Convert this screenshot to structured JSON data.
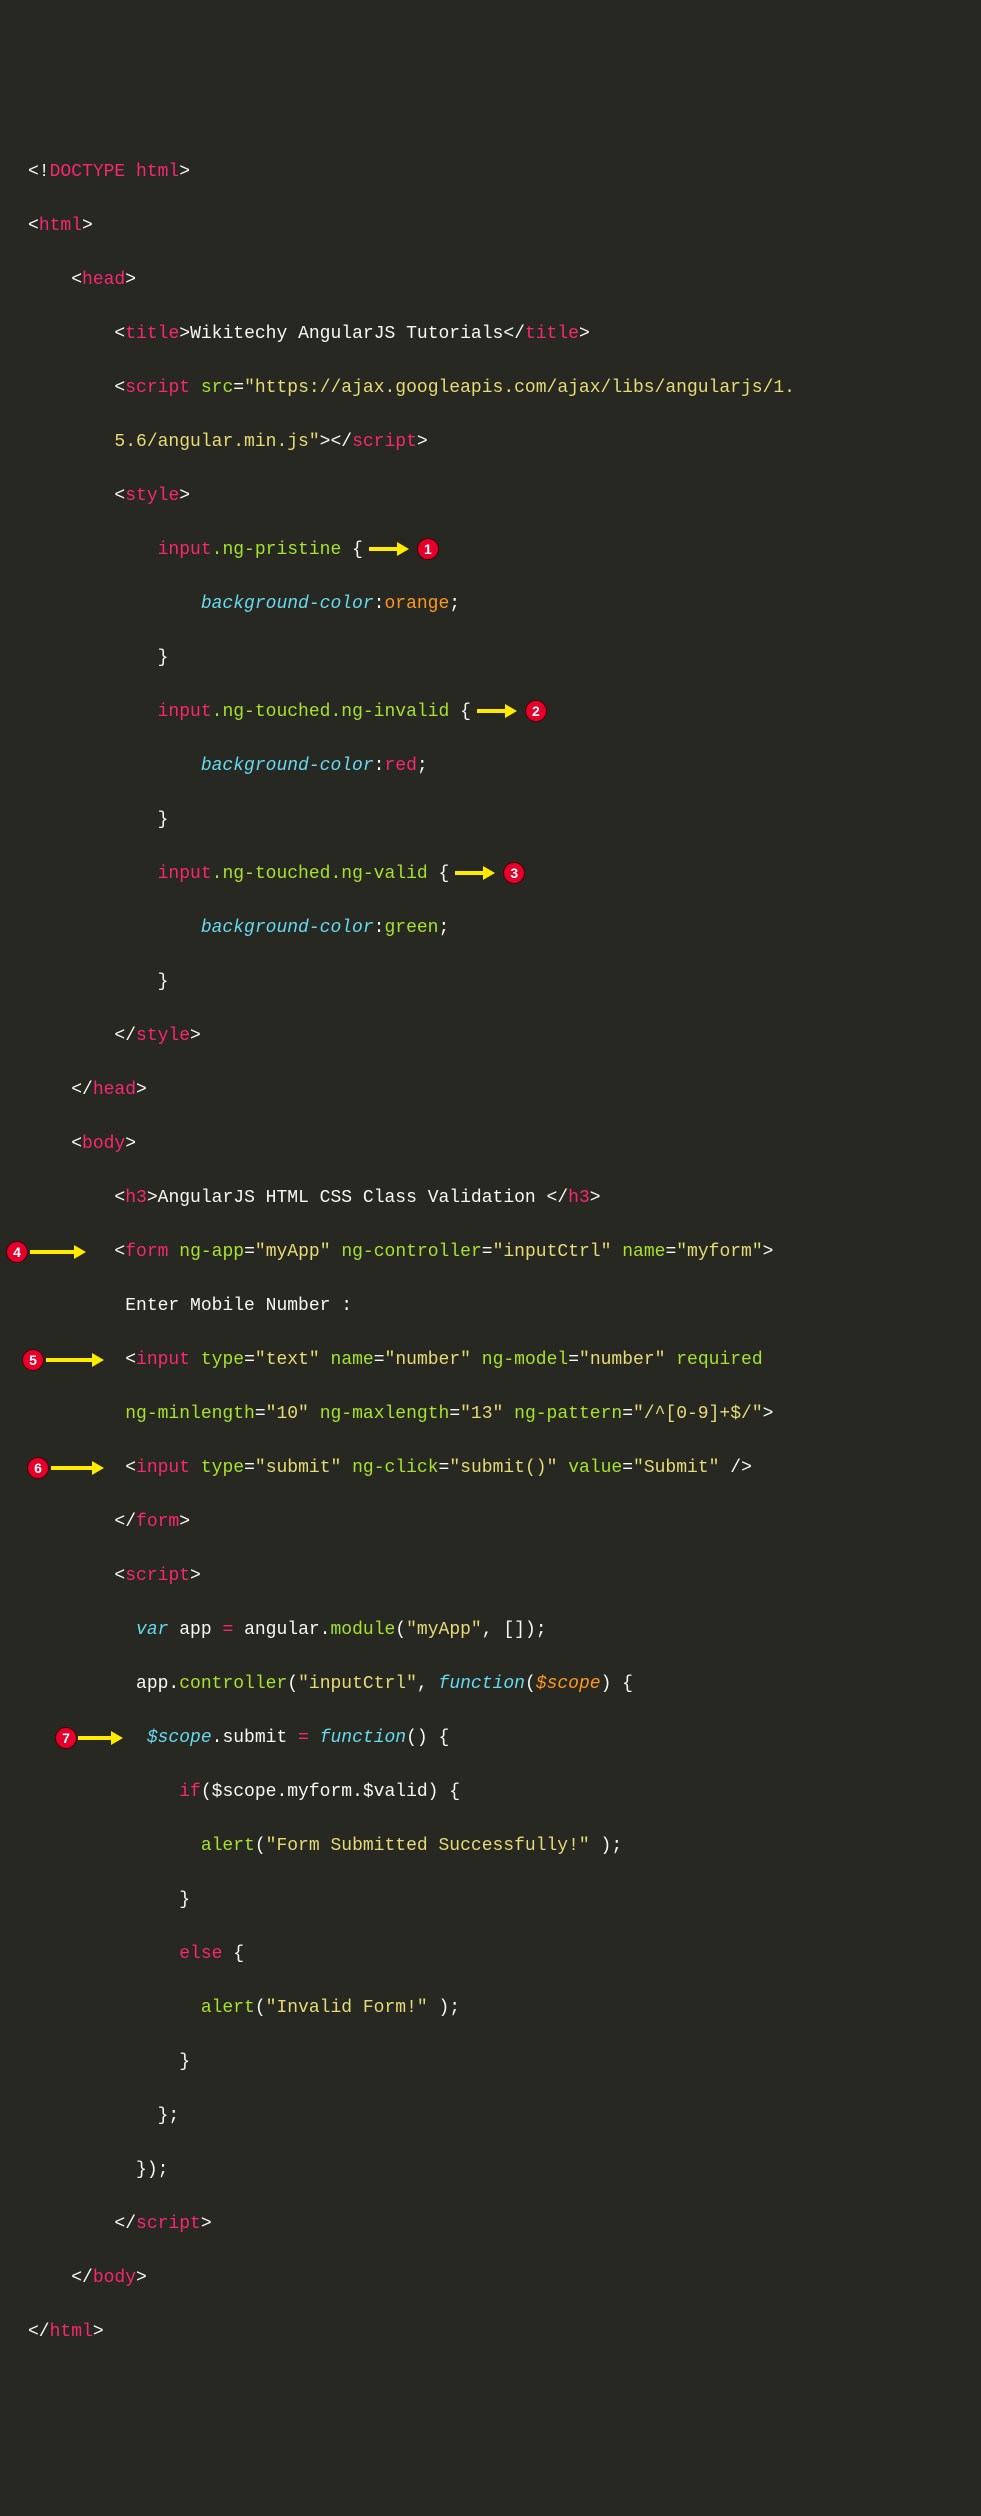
{
  "code": {
    "l1_doctype": "DOCTYPE html",
    "l2_html_open": "html",
    "l3_head_open": "head",
    "l4_title_tag": "title",
    "l4_title_text": "Wikitechy AngularJS Tutorials",
    "l5_script_tag": "script",
    "l5_src_attr": "src",
    "l5_src_val": "\"https://ajax.googleapis.com/ajax/libs/angularjs/1.",
    "l6_src_cont": "5.6/angular.min.js\"",
    "l7_style_open": "style",
    "l8_sel_input": "input",
    "l8_class": ".ng-pristine",
    "l9_prop": "background-color",
    "l9_val": "orange",
    "l11_sel_input": "input",
    "l11_class": ".ng-touched.ng-invalid",
    "l12_prop": "background-color",
    "l12_val": "red",
    "l14_sel_input": "input",
    "l14_class": ".ng-touched.ng-valid",
    "l15_prop": "background-color",
    "l15_val": "green",
    "l17_style_close": "style",
    "l18_head_close": "head",
    "l19_body_open": "body",
    "l20_h3": "h3",
    "l20_h3_text": "AngularJS HTML CSS Class Validation ",
    "l21_form": "form",
    "l21_ngapp_attr": "ng-app",
    "l21_ngapp_val": "\"myApp\"",
    "l21_ngctrl_attr": "ng-controller",
    "l21_ngctrl_val": "\"inputCtrl\"",
    "l21_name_attr": "name",
    "l21_name_val": "\"myform\"",
    "l22_text": "Enter Mobile Number : ",
    "l23_input": "input",
    "l23_type_attr": "type",
    "l23_type_val": "\"text\"",
    "l23_name_attr": "name",
    "l23_name_val": "\"number\"",
    "l23_model_attr": "ng-model",
    "l23_model_val": "\"number\"",
    "l23_req_attr": "required",
    "l24_min_attr": "ng-minlength",
    "l24_min_val": "\"10\"",
    "l24_max_attr": "ng-maxlength",
    "l24_max_val": "\"13\"",
    "l24_pat_attr": "ng-pattern",
    "l24_pat_val": "\"/^[0-9]+$/\"",
    "l25_input": "input",
    "l25_type_attr": "type",
    "l25_type_val": "\"submit\"",
    "l25_click_attr": "ng-click",
    "l25_click_val": "\"submit()\"",
    "l25_value_attr": "value",
    "l25_value_val": "\"Submit\"",
    "l26_form_close": "form",
    "l27_script_open": "script",
    "l28_var": "var",
    "l28_app_text": " app ",
    "l28_eq": "=",
    "l28_ang_text": " angular.",
    "l28_module": "module",
    "l28_myapp_str": "\"myApp\"",
    "l29_ctrl_call": "app.",
    "l29_controller": "controller",
    "l29_ctrlname": "\"inputCtrl\"",
    "l29_function": "function",
    "l29_scope": "$scope",
    "l30_scope": "$scope",
    "l30_submit": ".submit ",
    "l30_eq": "=",
    "l30_function": "function",
    "l31_if": "if",
    "l31_text": "($scope.myform.$valid) {",
    "l32_alert": "alert",
    "l32_str": "\"Form Submitted Successfully!\"",
    "l34_else": "else",
    "l35_alert": "alert",
    "l35_str": "\"Invalid Form!\"",
    "l39_script_close": "script",
    "l40_body_close": "body",
    "l41_html_close": "html"
  },
  "badges": {
    "b1": "1",
    "b2": "2",
    "b3": "3",
    "b4": "4",
    "b5": "5",
    "b6": "6",
    "b7": "7"
  },
  "colors": {
    "background": "#272822",
    "tag_pink": "#f92672",
    "attr_green": "#a6e22e",
    "string_yellow": "#e6db74",
    "keyword_blue": "#66d9ef",
    "orange": "#fd971f",
    "badge_red": "#e4002b",
    "arrow_yellow": "#ffeb00"
  }
}
